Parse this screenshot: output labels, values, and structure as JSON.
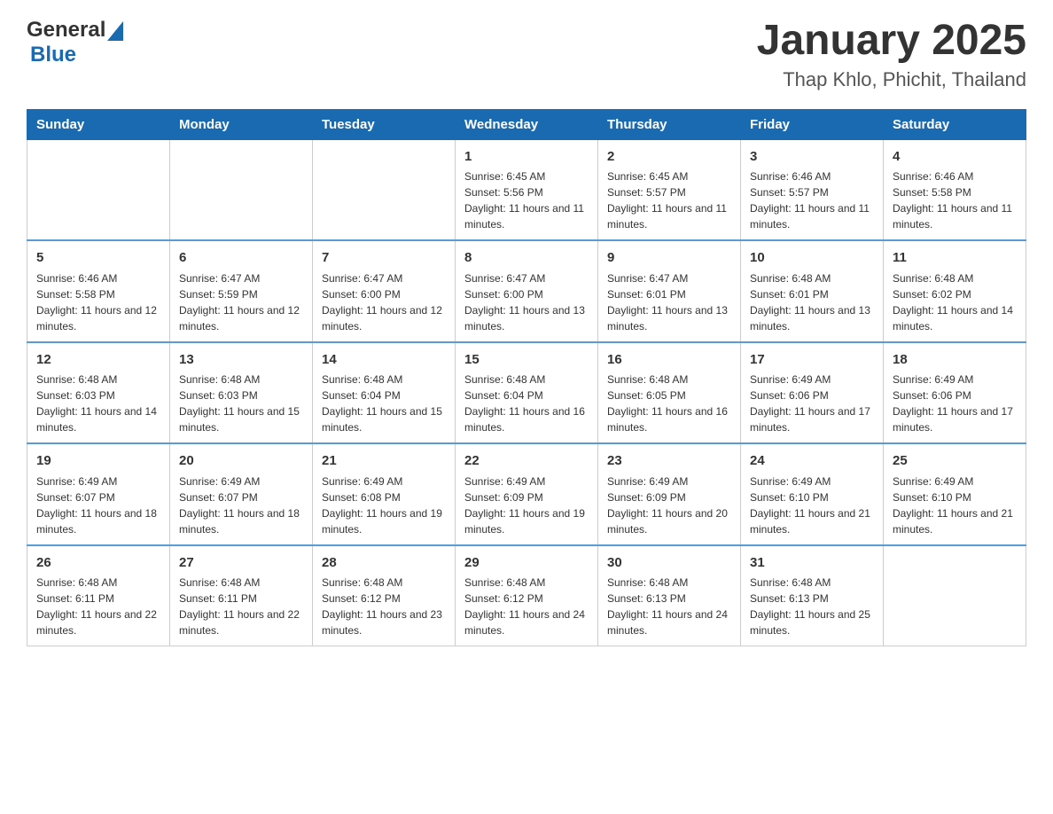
{
  "header": {
    "logo_general": "General",
    "logo_blue": "Blue",
    "title": "January 2025",
    "subtitle": "Thap Khlo, Phichit, Thailand"
  },
  "days_of_week": [
    "Sunday",
    "Monday",
    "Tuesday",
    "Wednesday",
    "Thursday",
    "Friday",
    "Saturday"
  ],
  "weeks": [
    [
      {
        "day": "",
        "sunrise": "",
        "sunset": "",
        "daylight": ""
      },
      {
        "day": "",
        "sunrise": "",
        "sunset": "",
        "daylight": ""
      },
      {
        "day": "",
        "sunrise": "",
        "sunset": "",
        "daylight": ""
      },
      {
        "day": "1",
        "sunrise": "Sunrise: 6:45 AM",
        "sunset": "Sunset: 5:56 PM",
        "daylight": "Daylight: 11 hours and 11 minutes."
      },
      {
        "day": "2",
        "sunrise": "Sunrise: 6:45 AM",
        "sunset": "Sunset: 5:57 PM",
        "daylight": "Daylight: 11 hours and 11 minutes."
      },
      {
        "day": "3",
        "sunrise": "Sunrise: 6:46 AM",
        "sunset": "Sunset: 5:57 PM",
        "daylight": "Daylight: 11 hours and 11 minutes."
      },
      {
        "day": "4",
        "sunrise": "Sunrise: 6:46 AM",
        "sunset": "Sunset: 5:58 PM",
        "daylight": "Daylight: 11 hours and 11 minutes."
      }
    ],
    [
      {
        "day": "5",
        "sunrise": "Sunrise: 6:46 AM",
        "sunset": "Sunset: 5:58 PM",
        "daylight": "Daylight: 11 hours and 12 minutes."
      },
      {
        "day": "6",
        "sunrise": "Sunrise: 6:47 AM",
        "sunset": "Sunset: 5:59 PM",
        "daylight": "Daylight: 11 hours and 12 minutes."
      },
      {
        "day": "7",
        "sunrise": "Sunrise: 6:47 AM",
        "sunset": "Sunset: 6:00 PM",
        "daylight": "Daylight: 11 hours and 12 minutes."
      },
      {
        "day": "8",
        "sunrise": "Sunrise: 6:47 AM",
        "sunset": "Sunset: 6:00 PM",
        "daylight": "Daylight: 11 hours and 13 minutes."
      },
      {
        "day": "9",
        "sunrise": "Sunrise: 6:47 AM",
        "sunset": "Sunset: 6:01 PM",
        "daylight": "Daylight: 11 hours and 13 minutes."
      },
      {
        "day": "10",
        "sunrise": "Sunrise: 6:48 AM",
        "sunset": "Sunset: 6:01 PM",
        "daylight": "Daylight: 11 hours and 13 minutes."
      },
      {
        "day": "11",
        "sunrise": "Sunrise: 6:48 AM",
        "sunset": "Sunset: 6:02 PM",
        "daylight": "Daylight: 11 hours and 14 minutes."
      }
    ],
    [
      {
        "day": "12",
        "sunrise": "Sunrise: 6:48 AM",
        "sunset": "Sunset: 6:03 PM",
        "daylight": "Daylight: 11 hours and 14 minutes."
      },
      {
        "day": "13",
        "sunrise": "Sunrise: 6:48 AM",
        "sunset": "Sunset: 6:03 PM",
        "daylight": "Daylight: 11 hours and 15 minutes."
      },
      {
        "day": "14",
        "sunrise": "Sunrise: 6:48 AM",
        "sunset": "Sunset: 6:04 PM",
        "daylight": "Daylight: 11 hours and 15 minutes."
      },
      {
        "day": "15",
        "sunrise": "Sunrise: 6:48 AM",
        "sunset": "Sunset: 6:04 PM",
        "daylight": "Daylight: 11 hours and 16 minutes."
      },
      {
        "day": "16",
        "sunrise": "Sunrise: 6:48 AM",
        "sunset": "Sunset: 6:05 PM",
        "daylight": "Daylight: 11 hours and 16 minutes."
      },
      {
        "day": "17",
        "sunrise": "Sunrise: 6:49 AM",
        "sunset": "Sunset: 6:06 PM",
        "daylight": "Daylight: 11 hours and 17 minutes."
      },
      {
        "day": "18",
        "sunrise": "Sunrise: 6:49 AM",
        "sunset": "Sunset: 6:06 PM",
        "daylight": "Daylight: 11 hours and 17 minutes."
      }
    ],
    [
      {
        "day": "19",
        "sunrise": "Sunrise: 6:49 AM",
        "sunset": "Sunset: 6:07 PM",
        "daylight": "Daylight: 11 hours and 18 minutes."
      },
      {
        "day": "20",
        "sunrise": "Sunrise: 6:49 AM",
        "sunset": "Sunset: 6:07 PM",
        "daylight": "Daylight: 11 hours and 18 minutes."
      },
      {
        "day": "21",
        "sunrise": "Sunrise: 6:49 AM",
        "sunset": "Sunset: 6:08 PM",
        "daylight": "Daylight: 11 hours and 19 minutes."
      },
      {
        "day": "22",
        "sunrise": "Sunrise: 6:49 AM",
        "sunset": "Sunset: 6:09 PM",
        "daylight": "Daylight: 11 hours and 19 minutes."
      },
      {
        "day": "23",
        "sunrise": "Sunrise: 6:49 AM",
        "sunset": "Sunset: 6:09 PM",
        "daylight": "Daylight: 11 hours and 20 minutes."
      },
      {
        "day": "24",
        "sunrise": "Sunrise: 6:49 AM",
        "sunset": "Sunset: 6:10 PM",
        "daylight": "Daylight: 11 hours and 21 minutes."
      },
      {
        "day": "25",
        "sunrise": "Sunrise: 6:49 AM",
        "sunset": "Sunset: 6:10 PM",
        "daylight": "Daylight: 11 hours and 21 minutes."
      }
    ],
    [
      {
        "day": "26",
        "sunrise": "Sunrise: 6:48 AM",
        "sunset": "Sunset: 6:11 PM",
        "daylight": "Daylight: 11 hours and 22 minutes."
      },
      {
        "day": "27",
        "sunrise": "Sunrise: 6:48 AM",
        "sunset": "Sunset: 6:11 PM",
        "daylight": "Daylight: 11 hours and 22 minutes."
      },
      {
        "day": "28",
        "sunrise": "Sunrise: 6:48 AM",
        "sunset": "Sunset: 6:12 PM",
        "daylight": "Daylight: 11 hours and 23 minutes."
      },
      {
        "day": "29",
        "sunrise": "Sunrise: 6:48 AM",
        "sunset": "Sunset: 6:12 PM",
        "daylight": "Daylight: 11 hours and 24 minutes."
      },
      {
        "day": "30",
        "sunrise": "Sunrise: 6:48 AM",
        "sunset": "Sunset: 6:13 PM",
        "daylight": "Daylight: 11 hours and 24 minutes."
      },
      {
        "day": "31",
        "sunrise": "Sunrise: 6:48 AM",
        "sunset": "Sunset: 6:13 PM",
        "daylight": "Daylight: 11 hours and 25 minutes."
      },
      {
        "day": "",
        "sunrise": "",
        "sunset": "",
        "daylight": ""
      }
    ]
  ]
}
